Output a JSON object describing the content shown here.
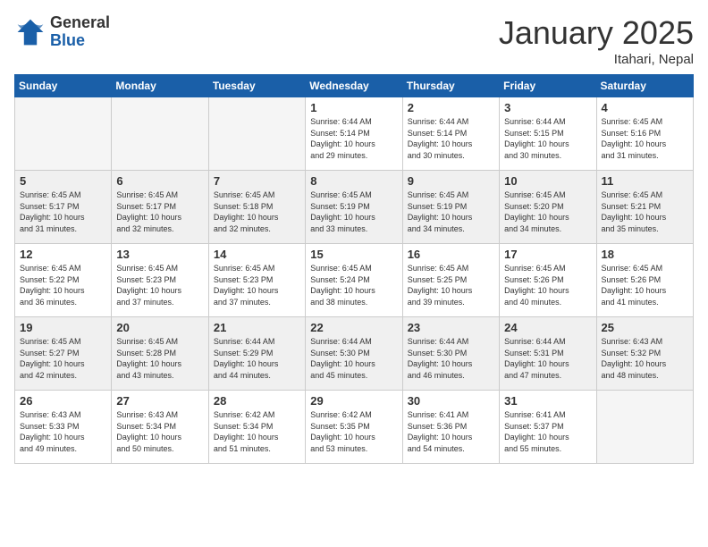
{
  "logo": {
    "general": "General",
    "blue": "Blue"
  },
  "header": {
    "month": "January 2025",
    "location": "Itahari, Nepal"
  },
  "weekdays": [
    "Sunday",
    "Monday",
    "Tuesday",
    "Wednesday",
    "Thursday",
    "Friday",
    "Saturday"
  ],
  "weeks": [
    {
      "shaded": false,
      "days": [
        {
          "num": "",
          "info": "",
          "empty": true
        },
        {
          "num": "",
          "info": "",
          "empty": true
        },
        {
          "num": "",
          "info": "",
          "empty": true
        },
        {
          "num": "1",
          "info": "Sunrise: 6:44 AM\nSunset: 5:14 PM\nDaylight: 10 hours\nand 29 minutes.",
          "empty": false
        },
        {
          "num": "2",
          "info": "Sunrise: 6:44 AM\nSunset: 5:14 PM\nDaylight: 10 hours\nand 30 minutes.",
          "empty": false
        },
        {
          "num": "3",
          "info": "Sunrise: 6:44 AM\nSunset: 5:15 PM\nDaylight: 10 hours\nand 30 minutes.",
          "empty": false
        },
        {
          "num": "4",
          "info": "Sunrise: 6:45 AM\nSunset: 5:16 PM\nDaylight: 10 hours\nand 31 minutes.",
          "empty": false
        }
      ]
    },
    {
      "shaded": true,
      "days": [
        {
          "num": "5",
          "info": "Sunrise: 6:45 AM\nSunset: 5:17 PM\nDaylight: 10 hours\nand 31 minutes.",
          "empty": false
        },
        {
          "num": "6",
          "info": "Sunrise: 6:45 AM\nSunset: 5:17 PM\nDaylight: 10 hours\nand 32 minutes.",
          "empty": false
        },
        {
          "num": "7",
          "info": "Sunrise: 6:45 AM\nSunset: 5:18 PM\nDaylight: 10 hours\nand 32 minutes.",
          "empty": false
        },
        {
          "num": "8",
          "info": "Sunrise: 6:45 AM\nSunset: 5:19 PM\nDaylight: 10 hours\nand 33 minutes.",
          "empty": false
        },
        {
          "num": "9",
          "info": "Sunrise: 6:45 AM\nSunset: 5:19 PM\nDaylight: 10 hours\nand 34 minutes.",
          "empty": false
        },
        {
          "num": "10",
          "info": "Sunrise: 6:45 AM\nSunset: 5:20 PM\nDaylight: 10 hours\nand 34 minutes.",
          "empty": false
        },
        {
          "num": "11",
          "info": "Sunrise: 6:45 AM\nSunset: 5:21 PM\nDaylight: 10 hours\nand 35 minutes.",
          "empty": false
        }
      ]
    },
    {
      "shaded": false,
      "days": [
        {
          "num": "12",
          "info": "Sunrise: 6:45 AM\nSunset: 5:22 PM\nDaylight: 10 hours\nand 36 minutes.",
          "empty": false
        },
        {
          "num": "13",
          "info": "Sunrise: 6:45 AM\nSunset: 5:23 PM\nDaylight: 10 hours\nand 37 minutes.",
          "empty": false
        },
        {
          "num": "14",
          "info": "Sunrise: 6:45 AM\nSunset: 5:23 PM\nDaylight: 10 hours\nand 37 minutes.",
          "empty": false
        },
        {
          "num": "15",
          "info": "Sunrise: 6:45 AM\nSunset: 5:24 PM\nDaylight: 10 hours\nand 38 minutes.",
          "empty": false
        },
        {
          "num": "16",
          "info": "Sunrise: 6:45 AM\nSunset: 5:25 PM\nDaylight: 10 hours\nand 39 minutes.",
          "empty": false
        },
        {
          "num": "17",
          "info": "Sunrise: 6:45 AM\nSunset: 5:26 PM\nDaylight: 10 hours\nand 40 minutes.",
          "empty": false
        },
        {
          "num": "18",
          "info": "Sunrise: 6:45 AM\nSunset: 5:26 PM\nDaylight: 10 hours\nand 41 minutes.",
          "empty": false
        }
      ]
    },
    {
      "shaded": true,
      "days": [
        {
          "num": "19",
          "info": "Sunrise: 6:45 AM\nSunset: 5:27 PM\nDaylight: 10 hours\nand 42 minutes.",
          "empty": false
        },
        {
          "num": "20",
          "info": "Sunrise: 6:45 AM\nSunset: 5:28 PM\nDaylight: 10 hours\nand 43 minutes.",
          "empty": false
        },
        {
          "num": "21",
          "info": "Sunrise: 6:44 AM\nSunset: 5:29 PM\nDaylight: 10 hours\nand 44 minutes.",
          "empty": false
        },
        {
          "num": "22",
          "info": "Sunrise: 6:44 AM\nSunset: 5:30 PM\nDaylight: 10 hours\nand 45 minutes.",
          "empty": false
        },
        {
          "num": "23",
          "info": "Sunrise: 6:44 AM\nSunset: 5:30 PM\nDaylight: 10 hours\nand 46 minutes.",
          "empty": false
        },
        {
          "num": "24",
          "info": "Sunrise: 6:44 AM\nSunset: 5:31 PM\nDaylight: 10 hours\nand 47 minutes.",
          "empty": false
        },
        {
          "num": "25",
          "info": "Sunrise: 6:43 AM\nSunset: 5:32 PM\nDaylight: 10 hours\nand 48 minutes.",
          "empty": false
        }
      ]
    },
    {
      "shaded": false,
      "days": [
        {
          "num": "26",
          "info": "Sunrise: 6:43 AM\nSunset: 5:33 PM\nDaylight: 10 hours\nand 49 minutes.",
          "empty": false
        },
        {
          "num": "27",
          "info": "Sunrise: 6:43 AM\nSunset: 5:34 PM\nDaylight: 10 hours\nand 50 minutes.",
          "empty": false
        },
        {
          "num": "28",
          "info": "Sunrise: 6:42 AM\nSunset: 5:34 PM\nDaylight: 10 hours\nand 51 minutes.",
          "empty": false
        },
        {
          "num": "29",
          "info": "Sunrise: 6:42 AM\nSunset: 5:35 PM\nDaylight: 10 hours\nand 53 minutes.",
          "empty": false
        },
        {
          "num": "30",
          "info": "Sunrise: 6:41 AM\nSunset: 5:36 PM\nDaylight: 10 hours\nand 54 minutes.",
          "empty": false
        },
        {
          "num": "31",
          "info": "Sunrise: 6:41 AM\nSunset: 5:37 PM\nDaylight: 10 hours\nand 55 minutes.",
          "empty": false
        },
        {
          "num": "",
          "info": "",
          "empty": true
        }
      ]
    }
  ]
}
